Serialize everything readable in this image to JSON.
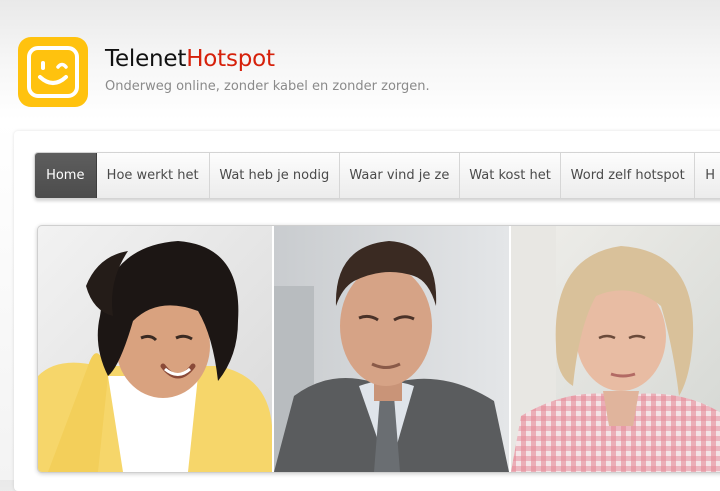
{
  "header": {
    "brand_part1": "Telenet",
    "brand_part2": "Hotspot",
    "tagline": "Onderweg online, zonder kabel en zonder zorgen.",
    "logo_icon": "telenet-winking-smiley-icon"
  },
  "nav": {
    "items": [
      {
        "label": "Home",
        "active": true
      },
      {
        "label": "Hoe werkt het"
      },
      {
        "label": "Wat heb je nodig"
      },
      {
        "label": "Waar vind je ze"
      },
      {
        "label": "Wat kost het"
      },
      {
        "label": "Word zelf hotspot"
      },
      {
        "label": "H"
      }
    ]
  },
  "banner": {
    "photos": [
      "smiling-woman-yellow-cardigan",
      "man-in-suit-looking-down",
      "blonde-woman-checked-shirt"
    ]
  },
  "colors": {
    "logo_yellow": "#ffc20e",
    "brand_red": "#d6210b",
    "nav_active": "#555555"
  }
}
